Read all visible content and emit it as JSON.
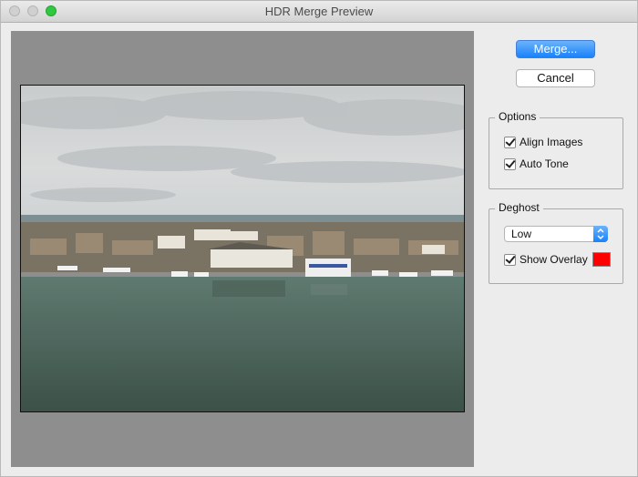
{
  "window": {
    "title": "HDR Merge Preview"
  },
  "buttons": {
    "merge_label": "Merge...",
    "cancel_label": "Cancel"
  },
  "options": {
    "legend": "Options",
    "align_images": {
      "label": "Align Images",
      "checked": true
    },
    "auto_tone": {
      "label": "Auto Tone",
      "checked": true
    }
  },
  "deghost": {
    "legend": "Deghost",
    "level": {
      "selected": "Low"
    },
    "show_overlay": {
      "label": "Show Overlay",
      "checked": true
    },
    "overlay_color": "#ff0000"
  },
  "colors": {
    "accent": "#1882fb",
    "preview_background": "#8e8e8e"
  },
  "icons": {
    "select_arrows": "up-down-chevron-icon"
  }
}
